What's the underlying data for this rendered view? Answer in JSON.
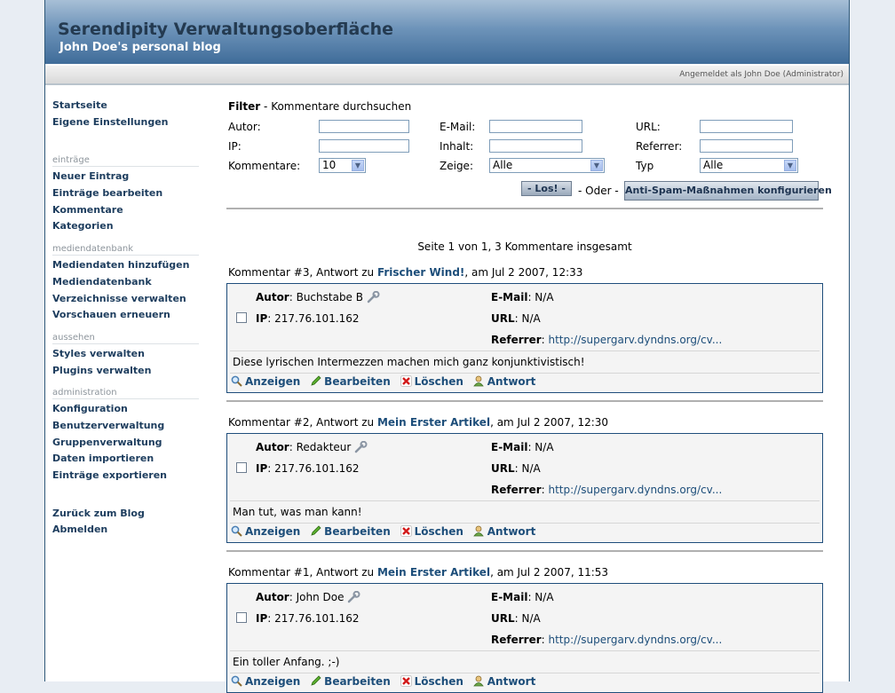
{
  "header": {
    "title": "Serendipity Verwaltungsoberfläche",
    "subtitle": "John Doe's personal blog",
    "logged_in": "Angemeldet als John Doe (Administrator)"
  },
  "sidebar": {
    "top": [
      "Startseite",
      "Eigene Einstellungen"
    ],
    "sections": [
      {
        "heading": "einträge",
        "items": [
          "Neuer Eintrag",
          "Einträge bearbeiten",
          "Kommentare",
          "Kategorien"
        ]
      },
      {
        "heading": "mediendatenbank",
        "items": [
          "Mediendaten hinzufügen",
          "Mediendatenbank",
          "Verzeichnisse verwalten",
          "Vorschauen erneuern"
        ]
      },
      {
        "heading": "aussehen",
        "items": [
          "Styles verwalten",
          "Plugins verwalten"
        ]
      },
      {
        "heading": "administration",
        "items": [
          "Konfiguration",
          "Benutzerverwaltung",
          "Gruppenverwaltung",
          "Daten importieren",
          "Einträge exportieren"
        ]
      }
    ],
    "bottom": [
      "Zurück zum Blog",
      "Abmelden"
    ]
  },
  "filter": {
    "title": "Filter",
    "subtitle": "- Kommentare durchsuchen",
    "labels": {
      "author": "Autor:",
      "email": "E-Mail:",
      "url": "URL:",
      "ip": "IP:",
      "content": "Inhalt:",
      "referrer": "Referrer:",
      "comments": "Kommentare:",
      "show": "Zeige:",
      "type": "Typ"
    },
    "comments_value": "10",
    "show_value": "Alle",
    "type_value": "Alle",
    "go_button": "- Los! -",
    "or_text": "- Oder -",
    "spam_button": "Anti-Spam-Maßnahmen konfigurieren"
  },
  "pager": "Seite 1 von 1, 3 Kommentare insgesamt",
  "labels": {
    "author": "Autor",
    "ip": "IP",
    "email": "E-Mail",
    "url": "URL",
    "referrer": "Referrer"
  },
  "actions": {
    "view": "Anzeigen",
    "edit": "Bearbeiten",
    "delete": "Löschen",
    "reply": "Antwort"
  },
  "comments": [
    {
      "head_pre": "Kommentar #3, Antwort zu ",
      "entry": "Frischer Wind!",
      "head_post": ", am Jul 2 2007, 12:33",
      "author": ": Buchstabe B",
      "ip": ": 217.76.101.162",
      "email": ": N/A",
      "url": ": N/A",
      "referrer": "http://supergarv.dyndns.org/cv...",
      "body": "Diese lyrischen Intermezzen machen mich ganz konjunktivistisch!"
    },
    {
      "head_pre": "Kommentar #2, Antwort zu ",
      "entry": "Mein Erster Artikel",
      "head_post": ", am Jul 2 2007, 12:30",
      "author": ": Redakteur",
      "ip": ": 217.76.101.162",
      "email": ": N/A",
      "url": ": N/A",
      "referrer": "http://supergarv.dyndns.org/cv...",
      "body": "Man tut, was man kann!"
    },
    {
      "head_pre": "Kommentar #1, Antwort zu ",
      "entry": "Mein Erster Artikel",
      "head_post": ", am Jul 2 2007, 11:53",
      "author": ": John Doe",
      "ip": ": 217.76.101.162",
      "email": ": N/A",
      "url": ": N/A",
      "referrer": "http://supergarv.dyndns.org/cv...",
      "body": "Ein toller Anfang. ;-)"
    }
  ]
}
